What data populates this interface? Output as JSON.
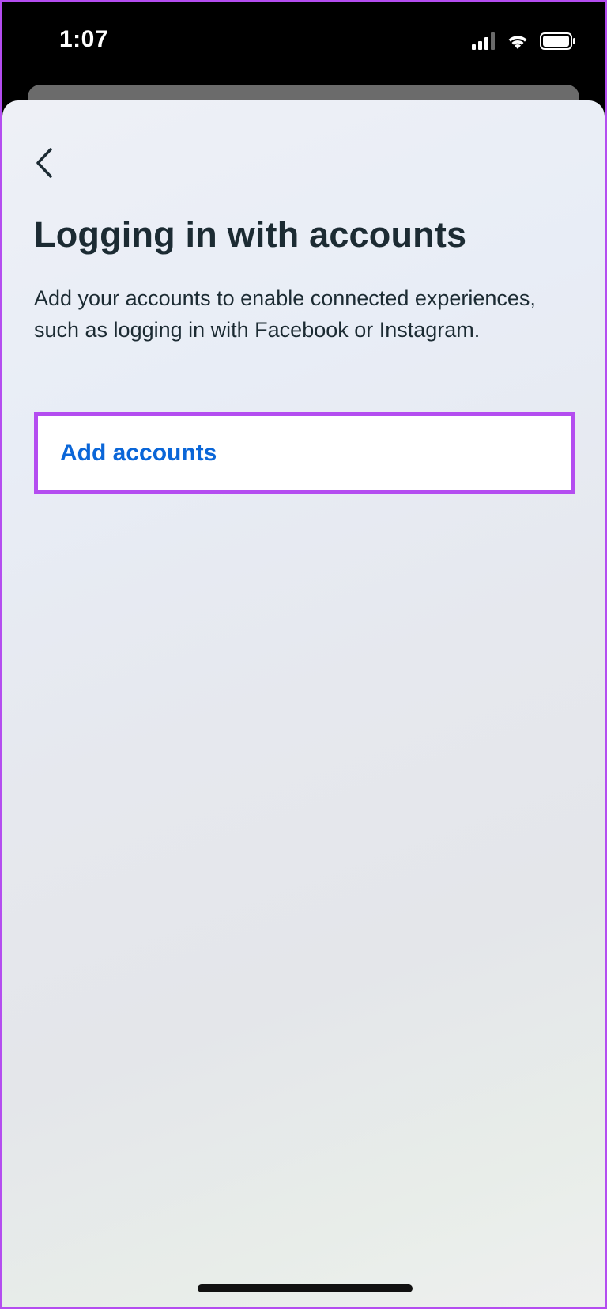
{
  "status_bar": {
    "time": "1:07",
    "icons": [
      "signal-icon",
      "wifi-icon",
      "battery-icon"
    ]
  },
  "page": {
    "back_icon": "chevron-left-icon",
    "title": "Logging in with accounts",
    "description": "Add your accounts to enable connected experiences, such as logging in with Facebook or Instagram.",
    "add_accounts_label": "Add accounts"
  },
  "colors": {
    "accent_link": "#0a66d8",
    "highlight_border": "#b44df0",
    "title_text": "#1c2b33"
  }
}
